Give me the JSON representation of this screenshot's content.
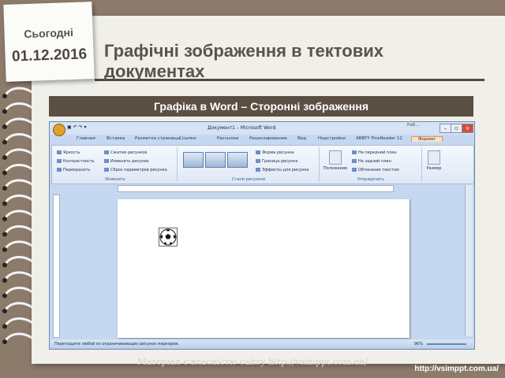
{
  "header": {
    "today_label": "Сьогодні",
    "date": "01.12.2016",
    "title": "Графічні зображення в тектових документах",
    "subtitle": "Графіка в Word – Сторонні зображення"
  },
  "word": {
    "window_title": "Документ1 – Microsoft Word",
    "context_tab": "Раб...",
    "tabs": [
      "Главная",
      "Вставка",
      "Разметка страницы",
      "Ссылки",
      "Рассылки",
      "Рецензирование",
      "Вид",
      "Надстройки",
      "ABBYY FineReader 12",
      "Формат"
    ],
    "adjust_group": {
      "items": [
        "Яркость",
        "Контрастность",
        "Перекрасить",
        "Сжатие рисунков",
        "Изменить рисунок",
        "Сброс параметров рисунка"
      ],
      "label": "Изменить"
    },
    "styles_group": {
      "items": [
        "Форма рисунка",
        "Граница рисунка",
        "Эффекты для рисунка"
      ],
      "label": "Стили рисунков"
    },
    "arrange_group": {
      "position_label": "Положение",
      "items": [
        "На передний план",
        "На задний план",
        "Обтекание текстом"
      ],
      "label": "Упорядочить"
    },
    "size_label": "Размер",
    "status_text": "Перетащите любой из ограничивающих рисунок маркеров.",
    "zoom": "90%"
  },
  "footer": {
    "copyright": "Матеріал є власністю сайту http://vsimppt.com.ua/",
    "url": "http://vsimppt.com.ua/"
  },
  "colors": {
    "background": "#8c7a6b",
    "subtitle_bar": "#5b4f44",
    "ribbon_blue": "#c5d8ef",
    "format_tab": "#fbe2c8"
  }
}
